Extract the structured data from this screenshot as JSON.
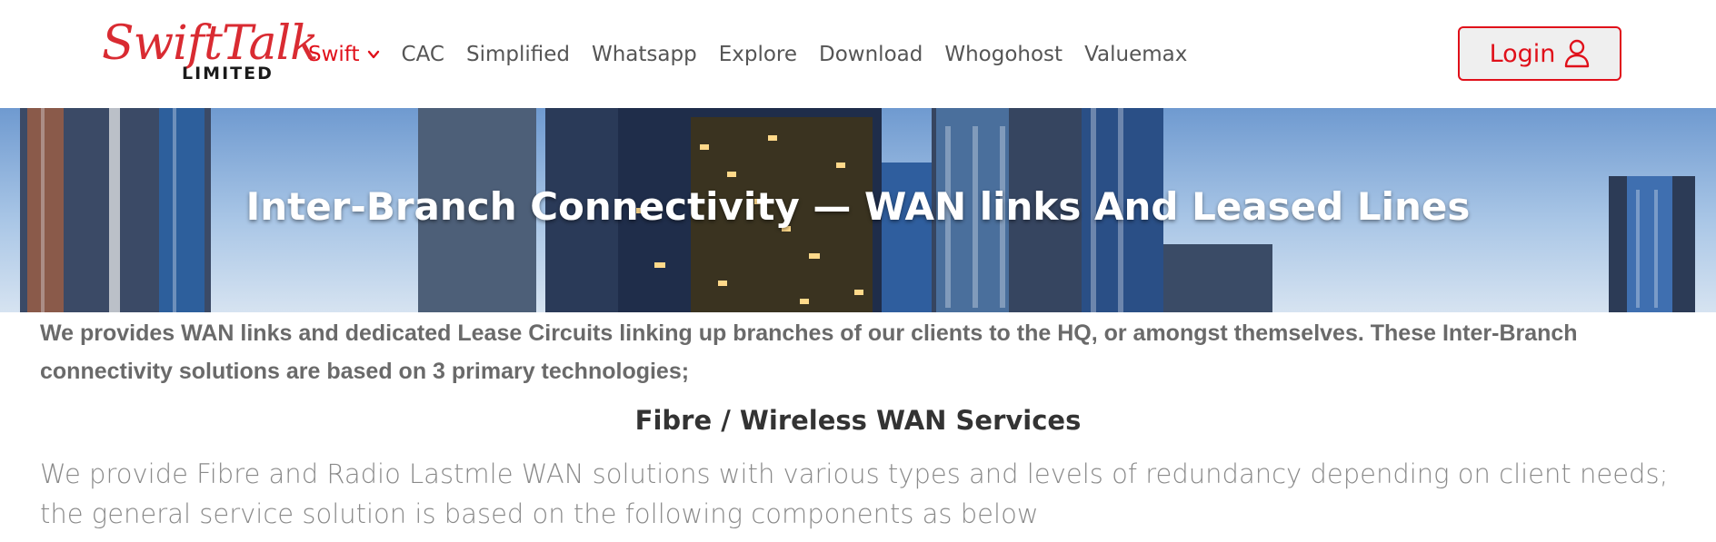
{
  "brand": {
    "name": "SwiftTalk",
    "sub": "LIMITED",
    "color": "#d92b32"
  },
  "nav": {
    "items": [
      {
        "label": "Swift",
        "active": true
      },
      {
        "label": "CAC"
      },
      {
        "label": "Simplified"
      },
      {
        "label": "Whatsapp"
      },
      {
        "label": "Explore"
      },
      {
        "label": "Download"
      },
      {
        "label": "Whogohost"
      },
      {
        "label": "Valuemax"
      }
    ],
    "dropdown_icon": "chevron-down-icon",
    "accent_color": "#e0101a"
  },
  "login": {
    "label": "Login",
    "icon": "user-icon"
  },
  "hero": {
    "title": "Inter-Branch Connectivity — WAN links And Leased Lines"
  },
  "content": {
    "intro": "We provides WAN links and dedicated Lease Circuits linking up branches of our clients to the HQ, or amongst themselves. These Inter-Branch connectivity solutions are based on 3 primary technologies;",
    "section_heading": "Fibre / Wireless WAN Services",
    "body": "We provide Fibre and Radio Lastmle WAN solutions with various types and levels of redundancy depending on client needs; the general service solution is based on the following components as below"
  }
}
